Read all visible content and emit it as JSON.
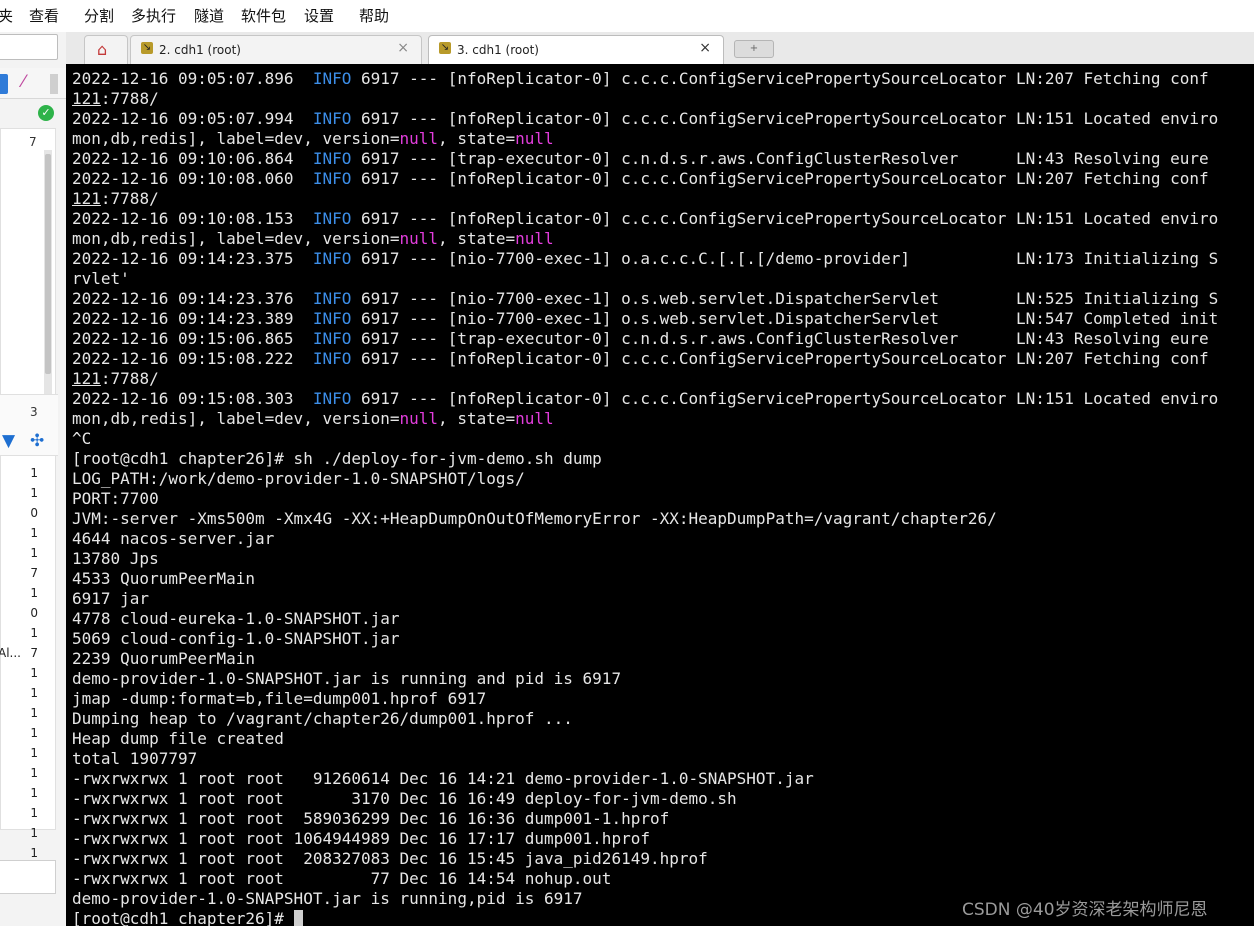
{
  "menu": [
    "夹",
    "查看",
    "分割",
    "多执行",
    "隧道",
    "软件包",
    "设置",
    "帮助"
  ],
  "tabs": [
    {
      "label": "2. cdh1 (root)",
      "close": "×",
      "active": false
    },
    {
      "label": "3. cdh1 (root)",
      "close": "×",
      "active": true
    }
  ],
  "new_tab_icon": "+",
  "sidebar": {
    "numbers": [
      "1",
      "1",
      "0",
      "1",
      "1",
      "7",
      "1",
      "0",
      "1",
      "7",
      "1",
      "1",
      "1",
      "1",
      "1",
      "1",
      "1",
      "1",
      "1",
      "1"
    ],
    "cut_label": "Al...",
    "count_top": "3",
    "count_header": "7"
  },
  "terminal_lines": [
    [
      {
        "t": "2022-12-16 09:05:07.896  "
      },
      {
        "t": "INFO",
        "c": "info"
      },
      {
        "t": " 6917 --- [nfoReplicator-0] c.c.c.ConfigServicePropertySourceLocator LN:207 Fetching conf"
      }
    ],
    [
      {
        "t": "121",
        "c": "ul"
      },
      {
        "t": ":7788/"
      }
    ],
    [
      {
        "t": "2022-12-16 09:05:07.994  "
      },
      {
        "t": "INFO",
        "c": "info"
      },
      {
        "t": " 6917 --- [nfoReplicator-0] c.c.c.ConfigServicePropertySourceLocator LN:151 Located enviro"
      }
    ],
    [
      {
        "t": "mon,db,redis], label=dev, version="
      },
      {
        "t": "null",
        "c": "null"
      },
      {
        "t": ", state="
      },
      {
        "t": "null",
        "c": "null"
      }
    ],
    [
      {
        "t": "2022-12-16 09:10:06.864  "
      },
      {
        "t": "INFO",
        "c": "info"
      },
      {
        "t": " 6917 --- [trap-executor-0] c.n.d.s.r.aws.ConfigClusterResolver      LN:43 Resolving eure"
      }
    ],
    [
      {
        "t": "2022-12-16 09:10:08.060  "
      },
      {
        "t": "INFO",
        "c": "info"
      },
      {
        "t": " 6917 --- [nfoReplicator-0] c.c.c.ConfigServicePropertySourceLocator LN:207 Fetching conf"
      }
    ],
    [
      {
        "t": "121",
        "c": "ul"
      },
      {
        "t": ":7788/"
      }
    ],
    [
      {
        "t": "2022-12-16 09:10:08.153  "
      },
      {
        "t": "INFO",
        "c": "info"
      },
      {
        "t": " 6917 --- [nfoReplicator-0] c.c.c.ConfigServicePropertySourceLocator LN:151 Located enviro"
      }
    ],
    [
      {
        "t": "mon,db,redis], label=dev, version="
      },
      {
        "t": "null",
        "c": "null"
      },
      {
        "t": ", state="
      },
      {
        "t": "null",
        "c": "null"
      }
    ],
    [
      {
        "t": "2022-12-16 09:14:23.375  "
      },
      {
        "t": "INFO",
        "c": "info"
      },
      {
        "t": " 6917 --- [nio-7700-exec-1] o.a.c.c.C.[.[.[/demo-provider]           LN:173 Initializing S"
      }
    ],
    [
      {
        "t": "rvlet'"
      }
    ],
    [
      {
        "t": "2022-12-16 09:14:23.376  "
      },
      {
        "t": "INFO",
        "c": "info"
      },
      {
        "t": " 6917 --- [nio-7700-exec-1] o.s.web.servlet.DispatcherServlet        LN:525 Initializing S"
      }
    ],
    [
      {
        "t": "2022-12-16 09:14:23.389  "
      },
      {
        "t": "INFO",
        "c": "info"
      },
      {
        "t": " 6917 --- [nio-7700-exec-1] o.s.web.servlet.DispatcherServlet        LN:547 Completed init"
      }
    ],
    [
      {
        "t": "2022-12-16 09:15:06.865  "
      },
      {
        "t": "INFO",
        "c": "info"
      },
      {
        "t": " 6917 --- [trap-executor-0] c.n.d.s.r.aws.ConfigClusterResolver      LN:43 Resolving eure"
      }
    ],
    [
      {
        "t": "2022-12-16 09:15:08.222  "
      },
      {
        "t": "INFO",
        "c": "info"
      },
      {
        "t": " 6917 --- [nfoReplicator-0] c.c.c.ConfigServicePropertySourceLocator LN:207 Fetching conf"
      }
    ],
    [
      {
        "t": "121",
        "c": "ul"
      },
      {
        "t": ":7788/"
      }
    ],
    [
      {
        "t": "2022-12-16 09:15:08.303  "
      },
      {
        "t": "INFO",
        "c": "info"
      },
      {
        "t": " 6917 --- [nfoReplicator-0] c.c.c.ConfigServicePropertySourceLocator LN:151 Located enviro"
      }
    ],
    [
      {
        "t": "mon,db,redis], label=dev, version="
      },
      {
        "t": "null",
        "c": "null"
      },
      {
        "t": ", state="
      },
      {
        "t": "null",
        "c": "null"
      }
    ],
    [
      {
        "t": "^C"
      }
    ],
    [
      {
        "t": "[root@cdh1 chapter26]# sh ./deploy-for-jvm-demo.sh dump"
      }
    ],
    [
      {
        "t": "LOG_PATH:/work/demo-provider-1.0-SNAPSHOT/logs/"
      }
    ],
    [
      {
        "t": "PORT:7700"
      }
    ],
    [
      {
        "t": "JVM:-server -Xms500m -Xmx4G -XX:+HeapDumpOnOutOfMemoryError -XX:HeapDumpPath=/vagrant/chapter26/"
      }
    ],
    [
      {
        "t": "4644 nacos-server.jar"
      }
    ],
    [
      {
        "t": "13780 Jps"
      }
    ],
    [
      {
        "t": "4533 QuorumPeerMain"
      }
    ],
    [
      {
        "t": "6917 jar"
      }
    ],
    [
      {
        "t": "4778 cloud-eureka-1.0-SNAPSHOT.jar"
      }
    ],
    [
      {
        "t": "5069 cloud-config-1.0-SNAPSHOT.jar"
      }
    ],
    [
      {
        "t": "2239 QuorumPeerMain"
      }
    ],
    [
      {
        "t": "demo-provider-1.0-SNAPSHOT.jar is running and pid is 6917"
      }
    ],
    [
      {
        "t": "jmap -dump:format=b,file=dump001.hprof 6917"
      }
    ],
    [
      {
        "t": "Dumping heap to /vagrant/chapter26/dump001.hprof ..."
      }
    ],
    [
      {
        "t": "Heap dump file created"
      }
    ],
    [
      {
        "t": "total 1907797"
      }
    ],
    [
      {
        "t": "-rwxrwxrwx 1 root root   91260614 Dec 16 14:21 demo-provider-1.0-SNAPSHOT.jar"
      }
    ],
    [
      {
        "t": "-rwxrwxrwx 1 root root       3170 Dec 16 16:49 deploy-for-jvm-demo.sh"
      }
    ],
    [
      {
        "t": "-rwxrwxrwx 1 root root  589036299 Dec 16 16:36 dump001-1.hprof"
      }
    ],
    [
      {
        "t": "-rwxrwxrwx 1 root root 1064944989 Dec 16 17:17 dump001.hprof"
      }
    ],
    [
      {
        "t": "-rwxrwxrwx 1 root root  208327083 Dec 16 15:45 java_pid26149.hprof"
      }
    ],
    [
      {
        "t": "-rwxrwxrwx 1 root root         77 Dec 16 14:54 nohup.out"
      }
    ],
    [
      {
        "t": "demo-provider-1.0-SNAPSHOT.jar is running,pid is 6917"
      }
    ],
    [
      {
        "t": "[root@cdh1 chapter26]# "
      },
      {
        "t": "",
        "c": "cursor"
      }
    ]
  ],
  "watermark": "CSDN @40岁资深老架构师尼恩",
  "colors": {
    "terminal_bg": "#000000",
    "terminal_fg": "#e6e6e6",
    "info": "#3c8ee8",
    "null": "#e23ddc"
  }
}
